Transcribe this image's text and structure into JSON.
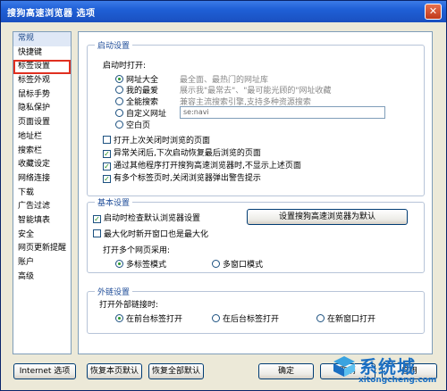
{
  "window": {
    "title": "搜狗高速浏览器 选项",
    "close_glyph": "✕"
  },
  "sidebar": {
    "items": [
      {
        "label": "常规"
      },
      {
        "label": "快捷键"
      },
      {
        "label": "标签设置"
      },
      {
        "label": "标签外观"
      },
      {
        "label": "鼠标手势"
      },
      {
        "label": "隐私保护"
      },
      {
        "label": "页面设置"
      },
      {
        "label": "地址栏"
      },
      {
        "label": "搜索栏"
      },
      {
        "label": "收藏设定"
      },
      {
        "label": "网络连接"
      },
      {
        "label": "下载"
      },
      {
        "label": "广告过滤"
      },
      {
        "label": "智能填表"
      },
      {
        "label": "安全"
      },
      {
        "label": "网页更新提醒"
      },
      {
        "label": "账户"
      },
      {
        "label": "高级"
      }
    ],
    "active_index": 0,
    "highlight_index": 2
  },
  "startup": {
    "legend": "启动设置",
    "on_start_label": "启动时打开:",
    "options": [
      {
        "label": "网址大全",
        "desc": "最全面、最热门的网址库",
        "selected": true
      },
      {
        "label": "我的最爱",
        "desc": "展示我\"最常去\"、\"最可能光顾的\"网址收藏",
        "selected": false
      },
      {
        "label": "全能搜索",
        "desc": "兼容主流搜索引擎,支持多种资源搜索",
        "selected": false
      },
      {
        "label": "自定义网址",
        "desc": "",
        "selected": false
      },
      {
        "label": "空白页",
        "desc": "",
        "selected": false
      }
    ],
    "custom_url_value": "se:navi",
    "checkboxes": [
      {
        "label": "打开上次关闭时浏览的页面",
        "checked": false
      },
      {
        "label": "异常关闭后,下次启动恢复最后浏览的页面",
        "checked": true
      },
      {
        "label": "通过其他程序打开搜狗高速浏览器时,不显示上述页面",
        "checked": true
      },
      {
        "label": "有多个标签页时,关闭浏览器弹出警告提示",
        "checked": true
      }
    ]
  },
  "basic": {
    "legend": "基本设置",
    "default_check": {
      "label": "启动时检查默认浏览器设置",
      "checked": true
    },
    "set_default_button": "设置搜狗高速浏览器为默认",
    "maximize_check": {
      "label": "最大化时新开窗口也是最大化",
      "checked": false
    },
    "multi_label": "打开多个网页采用:",
    "multi_options": [
      {
        "label": "多标签模式",
        "selected": true
      },
      {
        "label": "多窗口模式",
        "selected": false
      }
    ]
  },
  "external": {
    "legend": "外链设置",
    "label": "打开外部链接时:",
    "options": [
      {
        "label": "在前台标签打开",
        "selected": true
      },
      {
        "label": "在后台标签打开",
        "selected": false
      },
      {
        "label": "在新窗口打开",
        "selected": false
      }
    ]
  },
  "footer": {
    "internet_options": "Internet 选项",
    "restore_page": "恢复本页默认",
    "restore_all": "恢复全部默认",
    "ok": "确定",
    "cancel": "取消",
    "apply": "应用"
  },
  "watermark": {
    "text": "系统城",
    "url": "xitongcheng.com"
  },
  "colors": {
    "title_bar": "#1f5fd6",
    "legend": "#1f4d99",
    "highlight_box": "#e03020",
    "watermark": "#1b6fc2"
  }
}
